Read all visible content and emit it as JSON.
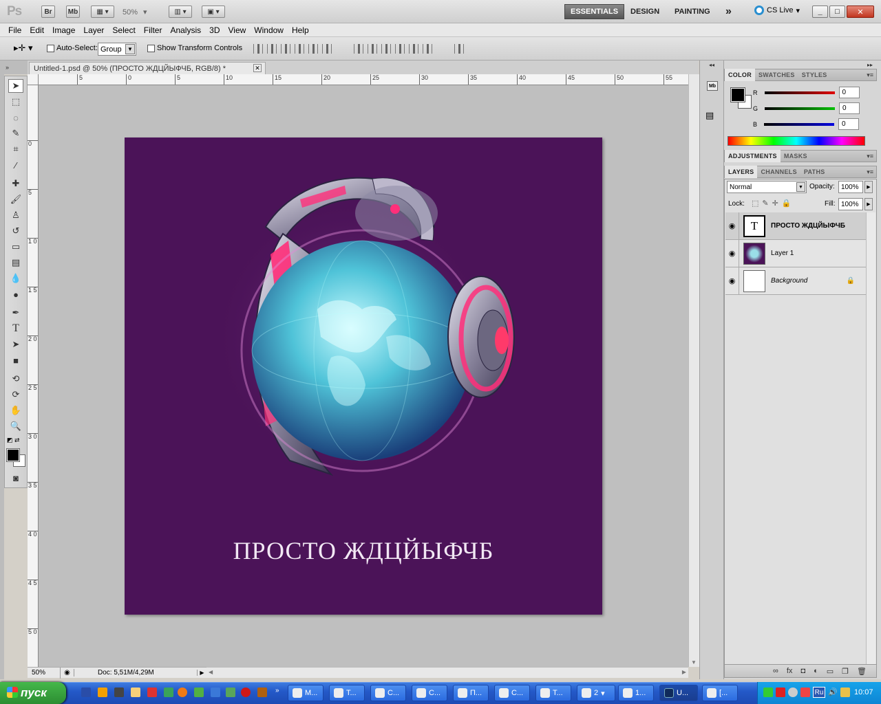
{
  "appbar": {
    "logo": "Ps",
    "bridge_label": "Br",
    "minibridge_label": "Mb",
    "zoom": "50%",
    "workspaces": [
      "ESSENTIALS",
      "DESIGN",
      "PAINTING"
    ],
    "more_workspaces": "»",
    "cslive": "CS Live",
    "window_buttons": [
      "_",
      "□",
      "✕"
    ]
  },
  "menu": [
    "File",
    "Edit",
    "Image",
    "Layer",
    "Select",
    "Filter",
    "Analysis",
    "3D",
    "View",
    "Window",
    "Help"
  ],
  "options": {
    "auto_select_label": "Auto-Select:",
    "auto_select_value": "Group",
    "show_transform_label": "Show Transform Controls"
  },
  "document": {
    "tab_title": "Untitled-1.psd @ 50% (ПРОСТО ЖДЦЙЫФЧБ, RGB/8) *",
    "canvas_text": "ПРОСТО ЖДЦЙЫФЧБ",
    "zoom_status": "50%",
    "doc_info": "Doc: 5,51M/4,29M"
  },
  "rulers": {
    "horizontal": [
      "5",
      "0",
      "5",
      "10",
      "15",
      "20",
      "25",
      "30",
      "35",
      "40",
      "45",
      "50",
      "55"
    ],
    "vertical": [
      "0",
      "5",
      "1 0",
      "1 5",
      "2 0",
      "2 5",
      "3 0",
      "3 5",
      "4 0",
      "4 5",
      "5 0"
    ]
  },
  "color_panel": {
    "tabs": [
      "COLOR",
      "SWATCHES",
      "STYLES"
    ],
    "channels": [
      {
        "label": "R",
        "value": "0",
        "color": "#e00000"
      },
      {
        "label": "G",
        "value": "0",
        "color": "#00b000"
      },
      {
        "label": "B",
        "value": "0",
        "color": "#0000e0"
      }
    ]
  },
  "adjust_panel": {
    "tabs": [
      "ADJUSTMENTS",
      "MASKS"
    ]
  },
  "layers_panel": {
    "tabs": [
      "LAYERS",
      "CHANNELS",
      "PATHS"
    ],
    "blend_mode": "Normal",
    "opacity_label": "Opacity:",
    "opacity_value": "100%",
    "lock_label": "Lock:",
    "fill_label": "Fill:",
    "fill_value": "100%",
    "text_thumb": "T",
    "layers": [
      {
        "name": "ПРОСТО ЖДЦЙЫФЧБ",
        "kind": "text"
      },
      {
        "name": "Layer 1",
        "kind": "image"
      },
      {
        "name": "Background",
        "kind": "background"
      }
    ]
  },
  "taskbar": {
    "start_label": "пуск",
    "buttons": [
      "M...",
      "T...",
      "C...",
      "C...",
      "П...",
      "C...",
      "T...",
      "2",
      "1...",
      "U...",
      "[..."
    ],
    "language": "Ru",
    "time": "10:07"
  }
}
